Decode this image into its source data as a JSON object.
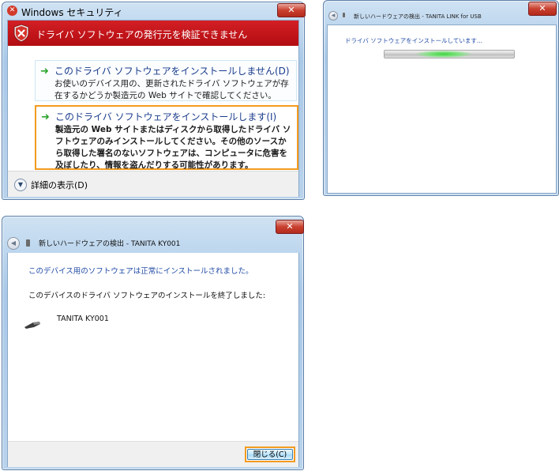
{
  "security_dialog": {
    "window_title": "Windows セキュリティ",
    "warning_banner": "ドライバ ソフトウェアの発行元を検証できません",
    "option_dont_install": {
      "title": "このドライバ ソフトウェアをインストールしません(D)",
      "description": "お使いのデバイス用の、更新されたドライバ ソフトウェアが存在するかどうか製造元の Web サイトで確認してください。"
    },
    "option_install": {
      "title": "このドライバ ソフトウェアをインストールします(I)",
      "description": "製造元の Web サイトまたはディスクから取得したドライバ ソフトウェアのみインストールしてください。その他のソースから取得した署名のないソフトウェアは、コンピュータに危害を及ぼしたり、情報を盗んだりする可能性があります。"
    },
    "details_label": "詳細の表示(D)"
  },
  "installing_dialog": {
    "header_title": "新しいハードウェアの検出 - TANITA LINK for USB",
    "status": "ドライバ ソフトウェアをインストールしています..."
  },
  "finished_dialog": {
    "header_title": "新しいハードウェアの検出 - TANITA KY001",
    "success_message": "このデバイス用のソフトウェアは正常にインストールされました。",
    "finish_message": "このデバイスのドライバ ソフトウェアのインストールを終了しました:",
    "device_name": "TANITA KY001",
    "close_button": "閉じる(C)"
  },
  "icons": [
    "shield-warning-icon",
    "green-arrow-icon",
    "chevron-down-icon",
    "close-icon",
    "back-arrow-icon",
    "usb-device-icon"
  ],
  "colors": {
    "banner_red": "#c8161b",
    "selection_orange": "#f39b1f",
    "link_blue": "#1a3c8c",
    "status_blue": "#1f4aa6"
  }
}
